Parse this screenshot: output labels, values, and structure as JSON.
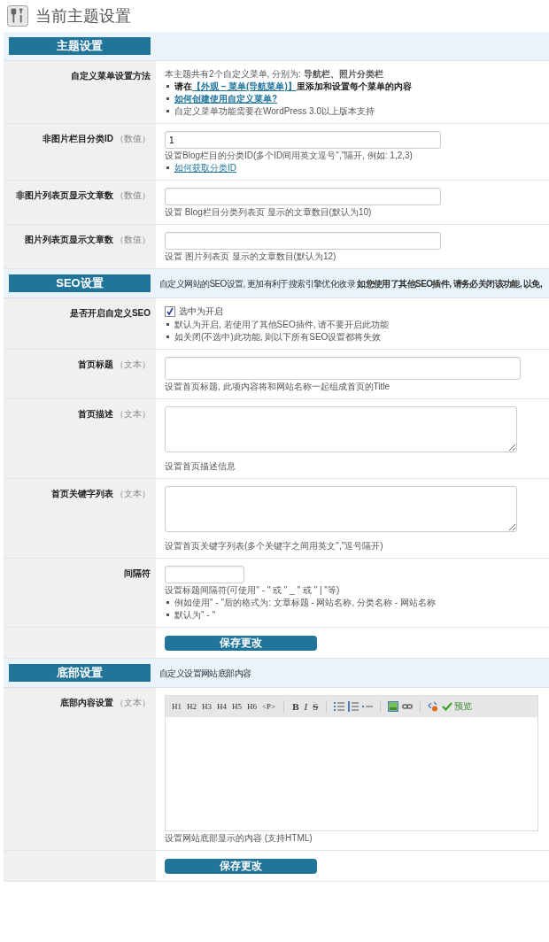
{
  "page_title": "当前主题设置",
  "sections": [
    {
      "heading": "主题设置",
      "rows": [
        {
          "label": "自定义菜单设置方法",
          "kind": "info",
          "notes": [
            {
              "bullet": false,
              "bold": false,
              "parts": [
                {
                  "text": "本主题共有2个自定义菜单, 分别为: **导航栏、照片分类栏**",
                  "link": false
                }
              ]
            },
            {
              "bullet": true,
              "bold": true,
              "parts": [
                {
                  "text": "请在",
                  "link": false
                },
                {
                  "text": "【外观 – 菜单(导航菜单)】",
                  "link": true
                },
                {
                  "text": "里添加和设置每个菜单的内容",
                  "link": false
                }
              ]
            },
            {
              "bullet": true,
              "bold": true,
              "parts": [
                {
                  "text": "如何创建使用自定义菜单?",
                  "link": true
                }
              ]
            },
            {
              "bullet": true,
              "bold": false,
              "parts": [
                {
                  "text": "自定义菜单功能需要在WordPress 3.0以上版本支持",
                  "link": false
                }
              ]
            }
          ]
        },
        {
          "label": "非图片栏目分类ID",
          "hint": "（数值）",
          "kind": "input",
          "value": "1",
          "notes": [
            {
              "bullet": false,
              "bold": false,
              "parts": [
                {
                  "text": "设置Blog栏目的分类ID(多个ID间用英文逗号\",\"隔开, 例如: 1,2,3)",
                  "link": false
                }
              ]
            },
            {
              "bullet": true,
              "bold": false,
              "parts": [
                {
                  "text": "如何获取分类ID",
                  "link": true
                }
              ]
            }
          ]
        },
        {
          "label": "非图片列表页显示文章数",
          "hint": "（数值）",
          "kind": "input",
          "notes": [
            {
              "bullet": false,
              "bold": false,
              "parts": [
                {
                  "text": "设置 Blog栏目分类列表页 显示的文章数目(默认为10)",
                  "link": false
                }
              ]
            }
          ]
        },
        {
          "label": "图片列表页显示文章数",
          "hint": "（数值）",
          "kind": "input",
          "notes": [
            {
              "bullet": false,
              "bold": false,
              "parts": [
                {
                  "text": "设置 图片列表页 显示的文章数目(默认为12)",
                  "link": false
                }
              ]
            }
          ]
        }
      ]
    },
    {
      "heading": "SEO设置",
      "description": "自定义网站的SEO设置, 更加有利于搜索引擎优化收录   **如您使用了其他SEO插件, 请务必关闭该功能, 以免,**",
      "rows": [
        {
          "label": "是否开启自定义SEO",
          "kind": "checkbox",
          "checked": true,
          "check_label": "选中为开启",
          "notes": [
            {
              "bullet": true,
              "bold": false,
              "parts": [
                {
                  "text": "默认为开启, 若使用了其他SEO插件, 请不要开启此功能",
                  "link": false
                }
              ]
            },
            {
              "bullet": true,
              "bold": false,
              "parts": [
                {
                  "text": "如关闭(不选中)此功能, 则以下所有SEO设置都将失效",
                  "link": false
                }
              ]
            }
          ]
        },
        {
          "label": "首页标题",
          "hint": "（文本）",
          "kind": "wide",
          "notes": [
            {
              "bullet": false,
              "bold": false,
              "parts": [
                {
                  "text": "设置首页标题, 此项内容将和网站名称一起组成首页的Title",
                  "link": false
                }
              ]
            }
          ]
        },
        {
          "label": "首页描述",
          "hint": "（文本）",
          "kind": "textarea",
          "notes": [
            {
              "bullet": false,
              "bold": false,
              "parts": [
                {
                  "text": "设置首页描述信息",
                  "link": false
                }
              ]
            }
          ]
        },
        {
          "label": "首页关键字列表",
          "hint": "（文本）",
          "kind": "textarea",
          "notes": [
            {
              "bullet": false,
              "bold": false,
              "parts": [
                {
                  "text": "设置首页关键字列表(多个关键字之间用英文\",\"逗号隔开)",
                  "link": false
                }
              ]
            }
          ]
        },
        {
          "label": "间隔符",
          "kind": "short",
          "notes": [
            {
              "bullet": false,
              "bold": false,
              "parts": [
                {
                  "text": "设置标题间隔符(可使用\" - \" 或 \" _ \" 或 \" | \"等)",
                  "link": false
                }
              ]
            },
            {
              "bullet": true,
              "bold": false,
              "parts": [
                {
                  "text": "例如使用\" - \"后的格式为: 文章标题 - 网站名称, 分类名称 - 网站名称",
                  "link": false
                }
              ]
            },
            {
              "bullet": true,
              "bold": false,
              "parts": [
                {
                  "text": "默认为\" - \"",
                  "link": false
                }
              ]
            }
          ]
        }
      ],
      "save_button": "保存更改"
    },
    {
      "heading": "底部设置",
      "description": "自定义设置网站底部内容",
      "rows": [
        {
          "label": "底部内容设置",
          "hint": "（文本）",
          "kind": "editor",
          "toolbar": [
            {
              "kind": "text",
              "label": "H1"
            },
            {
              "kind": "text",
              "label": "H2"
            },
            {
              "kind": "text",
              "label": "H3"
            },
            {
              "kind": "text",
              "label": "H4"
            },
            {
              "kind": "text",
              "label": "H5"
            },
            {
              "kind": "text",
              "label": "H6"
            },
            {
              "kind": "text",
              "label": "<P>"
            },
            {
              "kind": "sep"
            },
            {
              "kind": "bold",
              "label": "B"
            },
            {
              "kind": "italic",
              "label": "I"
            },
            {
              "kind": "strike",
              "label": "S"
            },
            {
              "kind": "sep"
            },
            {
              "kind": "bullet-list"
            },
            {
              "kind": "numbered-list"
            },
            {
              "kind": "rule"
            },
            {
              "kind": "sep"
            },
            {
              "kind": "image"
            },
            {
              "kind": "link"
            },
            {
              "kind": "sep"
            },
            {
              "kind": "code"
            },
            {
              "kind": "preview",
              "label": "预览"
            }
          ],
          "notes": [
            {
              "bullet": false,
              "bold": false,
              "parts": [
                {
                  "text": "设置网站底部显示的内容 (支持HTML)",
                  "link": false
                }
              ]
            }
          ]
        }
      ],
      "save_button": "保存更改"
    }
  ]
}
